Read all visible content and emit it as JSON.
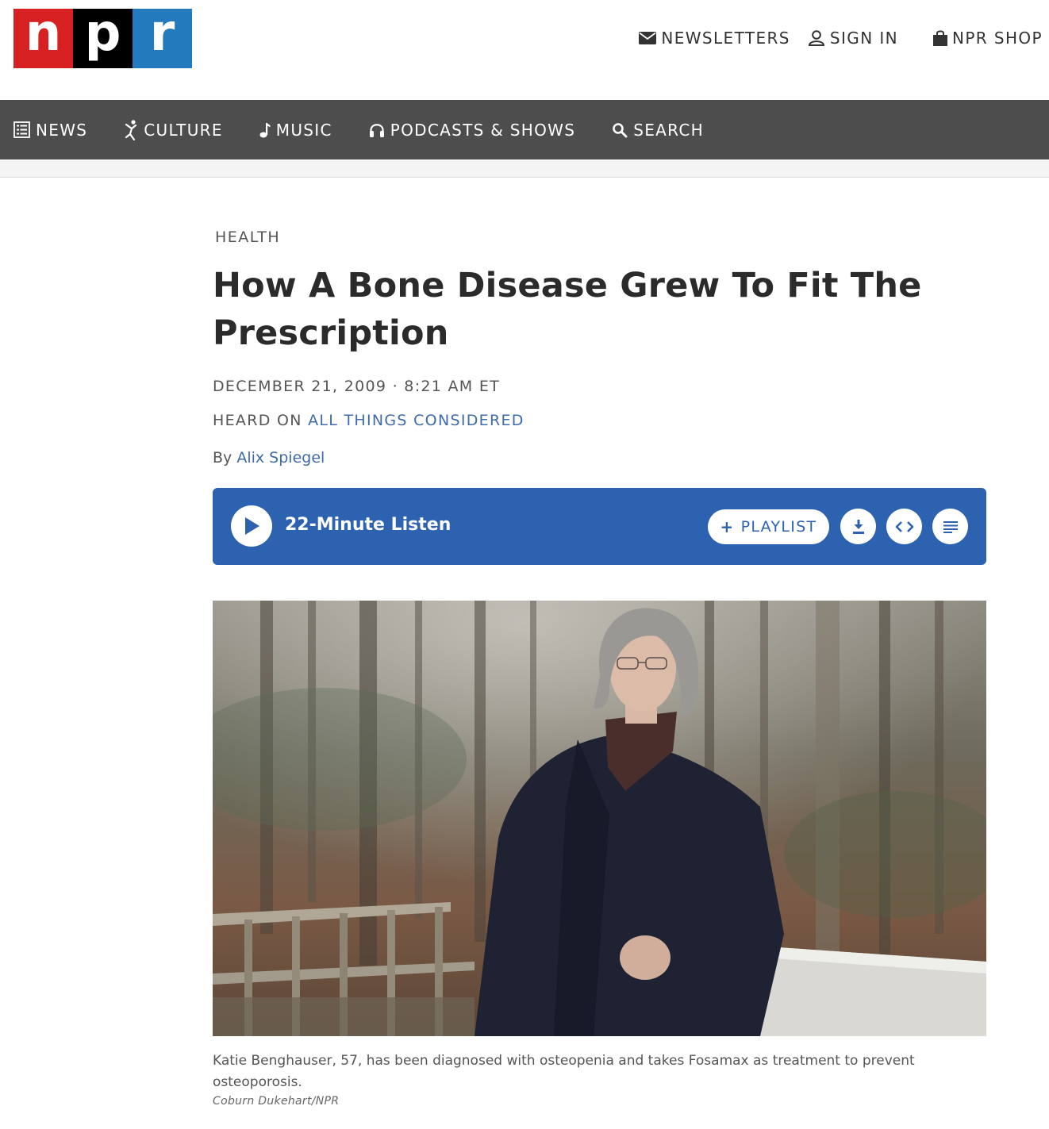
{
  "logo": {
    "letters": [
      "n",
      "p",
      "r"
    ],
    "colors": [
      "#d62021",
      "#000000",
      "#237bbd"
    ]
  },
  "utility": {
    "newsletters": "NEWSLETTERS",
    "sign_in": "SIGN IN",
    "shop": "NPR SHOP"
  },
  "nav": {
    "items": [
      {
        "label": "NEWS",
        "icon": "news-icon"
      },
      {
        "label": "CULTURE",
        "icon": "culture-icon"
      },
      {
        "label": "MUSIC",
        "icon": "music-note-icon"
      },
      {
        "label": "PODCASTS & SHOWS",
        "icon": "headphones-icon"
      },
      {
        "label": "SEARCH",
        "icon": "search-icon"
      }
    ]
  },
  "article": {
    "slug": "HEALTH",
    "headline": "How A Bone Disease Grew To Fit The Prescription",
    "dateline": "DECEMBER 21, 2009 · 8:21 AM ET",
    "heard_on_prefix": "HEARD ON ",
    "heard_on_program": "ALL THINGS CONSIDERED",
    "byline_prefix": "By ",
    "author": "Alix Spiegel"
  },
  "player": {
    "listen_label": "22-Minute Listen",
    "playlist_label": "PLAYLIST",
    "accent": "#2c62af"
  },
  "photo": {
    "caption": "Katie Benghauser, 57, has been diagnosed with osteopenia and takes Fosamax as treatment to prevent osteoporosis.",
    "credit": "Coburn Dukehart/NPR"
  }
}
